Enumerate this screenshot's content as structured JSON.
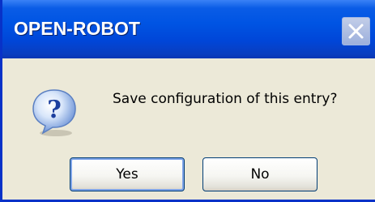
{
  "window": {
    "title": "OPEN-ROBOT",
    "close_icon": "close-icon"
  },
  "dialog": {
    "icon": "question-icon",
    "message": "Save configuration of this entry?",
    "buttons": {
      "yes_label": "Yes",
      "no_label": "No"
    }
  },
  "colors": {
    "titlebar": "#0054e3",
    "frame": "#0832c8",
    "client_bg": "#ece9d8",
    "button_border": "#003c74"
  }
}
